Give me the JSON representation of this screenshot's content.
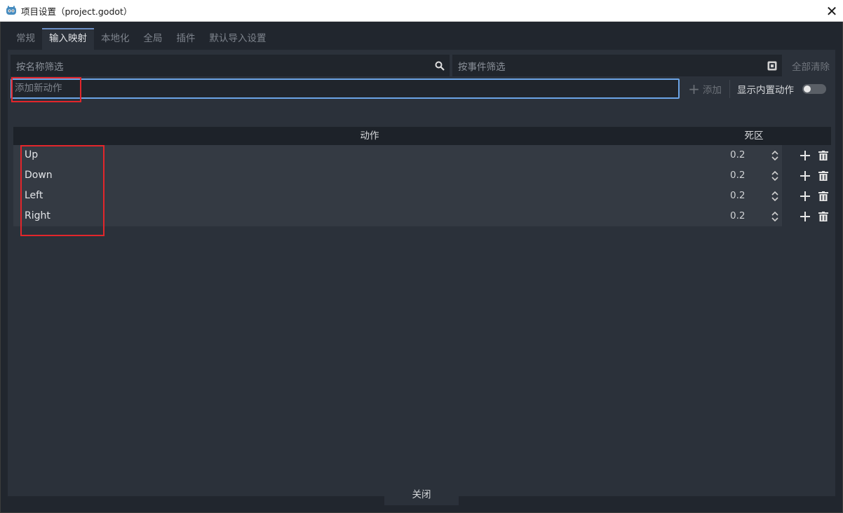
{
  "window": {
    "title": "项目设置（project.godot）",
    "close_glyph": "✕"
  },
  "tabs": [
    {
      "label": "常规"
    },
    {
      "label": "输入映射",
      "active": true
    },
    {
      "label": "本地化"
    },
    {
      "label": "全局"
    },
    {
      "label": "插件"
    },
    {
      "label": "默认导入设置"
    }
  ],
  "filters": {
    "name_placeholder": "按名称筛选",
    "event_placeholder": "按事件筛选",
    "clear_all": "全部清除",
    "name_icon": "search-icon",
    "event_icon": "keyboard-icon"
  },
  "new_action": {
    "placeholder": "添加新动作",
    "add_label": "添加",
    "builtin_label": "显示内置动作",
    "builtin_enabled": false
  },
  "table": {
    "col_action": "动作",
    "col_deadzone": "死区",
    "rows": [
      {
        "name": "Up",
        "deadzone": "0.2"
      },
      {
        "name": "Down",
        "deadzone": "0.2"
      },
      {
        "name": "Left",
        "deadzone": "0.2"
      },
      {
        "name": "Right",
        "deadzone": "0.2"
      }
    ]
  },
  "footer": {
    "close_label": "关闭"
  },
  "colors": {
    "accent": "#6ba4e6",
    "highlight_red": "#e3262b",
    "panel": "#2b313a",
    "background": "#21262e"
  }
}
